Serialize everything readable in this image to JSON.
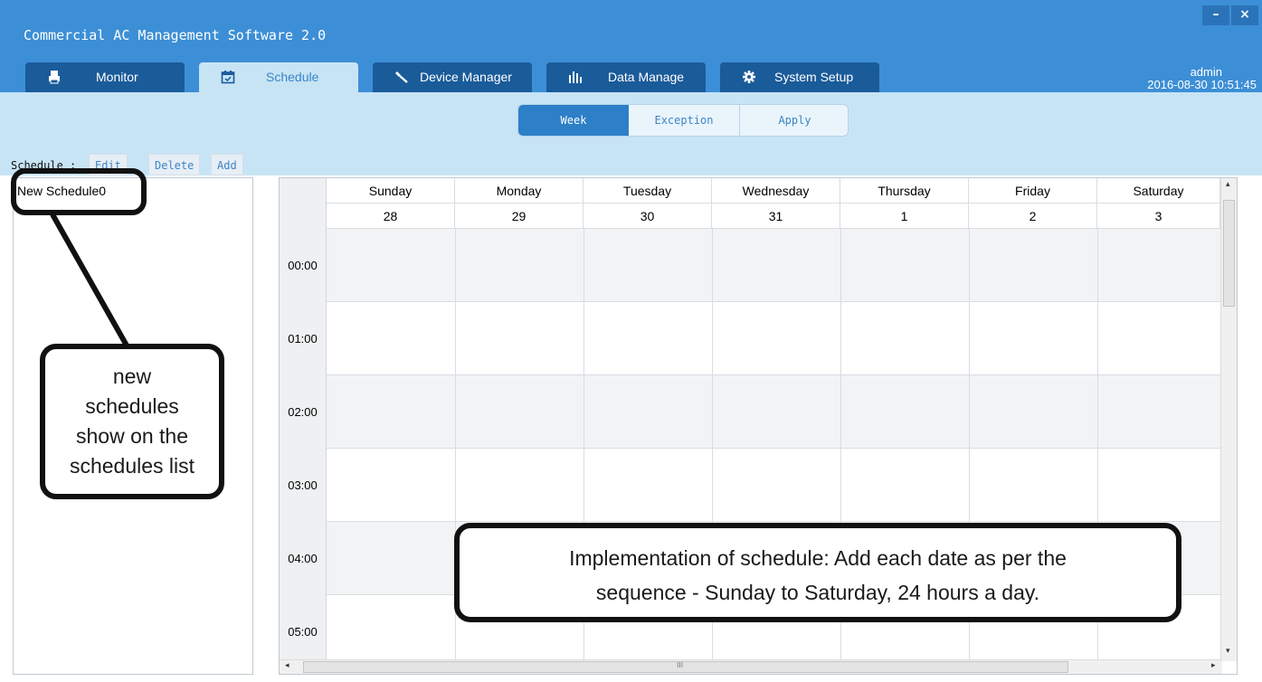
{
  "window": {
    "title": "Commercial AC Management Software 2.0",
    "minimize_glyph": "–",
    "close_glyph": "×"
  },
  "tabs": [
    {
      "label": "Monitor",
      "icon": "printer-icon",
      "active": false
    },
    {
      "label": "Schedule",
      "icon": "calendar-icon",
      "active": true
    },
    {
      "label": "Device Manager",
      "icon": "wrench-icon",
      "active": false
    },
    {
      "label": "Data Manage",
      "icon": "bar-chart-icon",
      "active": false
    },
    {
      "label": "System Setup",
      "icon": "gear-icon",
      "active": false
    }
  ],
  "user": {
    "name": "admin",
    "datetime": "2016-08-30 10:51:45"
  },
  "view_modes": [
    {
      "label": "Week",
      "active": true
    },
    {
      "label": "Exception",
      "active": false
    },
    {
      "label": "Apply",
      "active": false
    }
  ],
  "schedule_toolbar": {
    "label": "Schedule :",
    "edit": "Edit",
    "delete": "Delete",
    "add": "Add"
  },
  "schedules": [
    "New Schedule0"
  ],
  "calendar": {
    "days": [
      "Sunday",
      "Monday",
      "Tuesday",
      "Wednesday",
      "Thursday",
      "Friday",
      "Saturday"
    ],
    "dates": [
      "28",
      "29",
      "30",
      "31",
      "1",
      "2",
      "3"
    ],
    "hours": [
      "00:00",
      "01:00",
      "02:00",
      "03:00",
      "04:00",
      "05:00"
    ],
    "scroll_arrow_left": "◂",
    "scroll_arrow_right": "▸",
    "scroll_arrow_up": "▴",
    "scroll_arrow_down": "▾",
    "scroll_grip": "III"
  },
  "annotations": {
    "list_note": [
      "new",
      "schedules",
      "show on the",
      "schedules list"
    ],
    "implementation_note": [
      "Implementation of schedule: Add each date as per the",
      "sequence - Sunday to Saturday, 24 hours a day."
    ]
  },
  "colors": {
    "titlebar": "#3c8fd6",
    "tab_inactive": "#1a5b9a",
    "band": "#c7e4f5",
    "accent": "#2d7fc7"
  }
}
